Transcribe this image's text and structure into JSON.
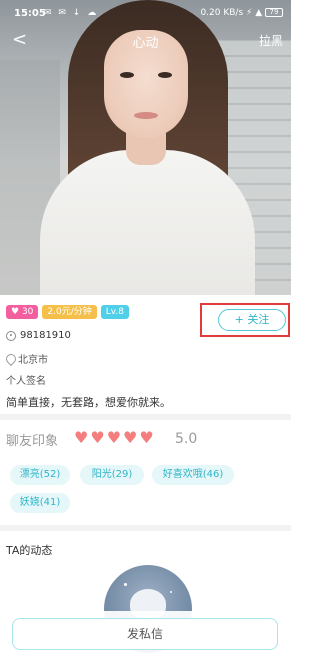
{
  "status_bar": {
    "time": "15:05",
    "left_icons": "✉ ✉ ↓ ☁",
    "right_text": "0.20 KB/s ⚡ ▲",
    "battery": "79"
  },
  "nav": {
    "back_symbol": "<",
    "title": "心动",
    "block_label": "拉黑"
  },
  "badges": {
    "heart_count": "30",
    "price": "2.0元/分钟",
    "level": "Lv.8"
  },
  "follow_label": "+ 关注",
  "profile": {
    "user_id": "98181910",
    "location": "北京市",
    "signature_label": "个人签名",
    "signature_text": "简单直接，无套路，想爱你就来。"
  },
  "impression": {
    "title": "聊友印象",
    "hearts": 5,
    "score": "5.0"
  },
  "tags": [
    {
      "label": "漂亮(52)"
    },
    {
      "label": "阳光(29)"
    },
    {
      "label": "好喜欢哦(46)"
    },
    {
      "label": "妖娆(41)"
    }
  ],
  "moments": {
    "title": "TA的动态"
  },
  "actions": {
    "message_label": "发私信"
  },
  "colors": {
    "accent": "#2fb5c9",
    "heart": "#f47d7d",
    "highlight_box": "#e23b3b"
  }
}
